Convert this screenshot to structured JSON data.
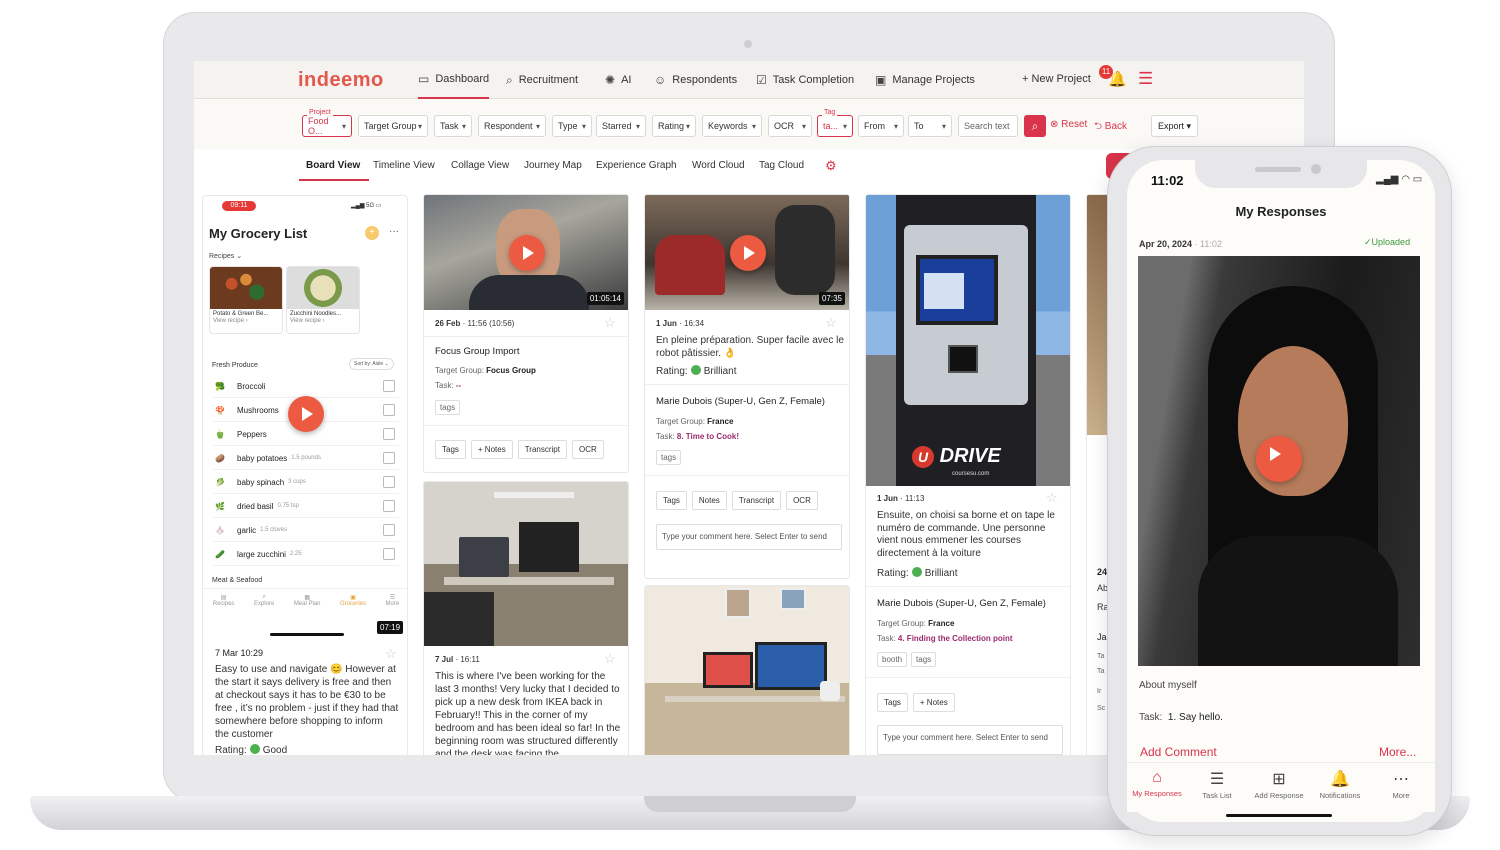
{
  "nav": {
    "logo": "indeemo",
    "items": [
      {
        "label": "Dashboard",
        "icon": "calendar-icon"
      },
      {
        "label": "Recruitment",
        "icon": "search-person-icon"
      },
      {
        "label": "AI",
        "icon": "lightbulb-icon"
      },
      {
        "label": "Respondents",
        "icon": "person-icon"
      },
      {
        "label": "Task Completion",
        "icon": "checkbox-icon"
      },
      {
        "label": "Manage Projects",
        "icon": "inbox-icon"
      }
    ],
    "new_project": "+ New Project",
    "notification_count": "11"
  },
  "filters": {
    "project_label": "Project",
    "project_value": "Food O...",
    "target_group": "Target Group",
    "task": "Task",
    "respondent": "Respondent",
    "type": "Type",
    "starred": "Starred",
    "rating": "Rating",
    "keywords": "Keywords",
    "ocr": "OCR",
    "tag_label": "Tag",
    "tag_value": "ta...",
    "from": "From",
    "to": "To",
    "search_placeholder": "Search text",
    "reset": "Reset",
    "back": "Back",
    "export": "Export"
  },
  "views": [
    "Board View",
    "Timeline View",
    "Collage View",
    "Journey Map",
    "Experience Graph",
    "Word Cloud",
    "Tag Cloud"
  ],
  "grocery": {
    "time": "09:11",
    "signal": "5G",
    "title": "My Grocery List",
    "recipes_label": "Recipes",
    "recipes": [
      {
        "name": "Potato & Green Be...",
        "link": "View recipe"
      },
      {
        "name": "Zucchini Noodles...",
        "link": "View recipe"
      }
    ],
    "section": "Fresh Produce",
    "sort": "Sort by: Aisle",
    "items": [
      {
        "name": "Broccoli",
        "qty": "",
        "icon": "🥦"
      },
      {
        "name": "Mushrooms",
        "qty": "",
        "icon": "🍄"
      },
      {
        "name": "Peppers",
        "qty": "",
        "icon": "🫑"
      },
      {
        "name": "baby potatoes",
        "qty": "1.5 pounds",
        "icon": "🥔"
      },
      {
        "name": "baby spinach",
        "qty": "3 cups",
        "icon": "🥬"
      },
      {
        "name": "dried basil",
        "qty": "0.75 tsp",
        "icon": "🌿"
      },
      {
        "name": "garlic",
        "qty": "1.5 cloves",
        "icon": "🧄"
      },
      {
        "name": "large zucchini",
        "qty": "2.25",
        "icon": "🥒"
      }
    ],
    "meat_section": "Meat & Seafood",
    "tabs": [
      "Recipes",
      "Explore",
      "Meal Plan",
      "Groceries",
      "More"
    ],
    "duration": "07:19",
    "date": "7 Mar 10:29",
    "text": "Easy to use and navigate 😊 However at the start it says delivery is free and then at checkout says it has to be €30 to be free , it’s no problem - just if they had that somewhere before shopping to inform the customer",
    "rating_label": "Rating:",
    "rating_value": "Good"
  },
  "cards": {
    "c1": {
      "duration": "01:05:14",
      "date": "26 Feb",
      "time": "· 11:56 (10:56)",
      "title": "Focus Group Import",
      "tg_label": "Target Group:",
      "tg_value": "Focus Group",
      "task_label": "Task:",
      "task_value": "--",
      "tag": "tags",
      "buttons": [
        "Tags",
        "+ Notes",
        "Transcript",
        "OCR"
      ]
    },
    "c2": {
      "date": "7 Jul",
      "time": "· 16:11",
      "text": "This is where I've been working for the last 3 months! Very lucky that I decided to pick up a new desk from IKEA back in February!! This in the corner of my bedroom and has been ideal so far! In the beginning room was structured differently and the desk was facing the"
    },
    "c3": {
      "duration": "07:35",
      "date": "1 Jun",
      "time": "· 16:34",
      "text": "En pleine préparation. Super facile avec le robot pâtissier. 👌",
      "rating_label": "Rating:",
      "rating_value": "Brilliant",
      "respondent": "Marie Dubois (Super-U, Gen Z, Female)",
      "tg_label": "Target Group:",
      "tg_value": "France",
      "task_label": "Task:",
      "task_value": "8. Time to Cook!",
      "tag": "tags",
      "buttons": [
        "Tags",
        "Notes",
        "Transcript",
        "OCR"
      ],
      "comment_placeholder": "Type your comment here. Select Enter to send"
    },
    "c4": {
      "brand": "DRIVE",
      "brand_sub": "coursesu.com",
      "date": "1 Jun",
      "time": "· 11:13",
      "text": "Ensuite, on choisi sa borne et on tape le numéro de commande. Une personne vient nous emmener les courses directement à la voiture",
      "rating_label": "Rating:",
      "rating_value": "Brilliant",
      "respondent": "Marie Dubois (Super-U, Gen Z, Female)",
      "tg_label": "Target Group:",
      "tg_value": "France",
      "task_label": "Task:",
      "task_value": "4. Finding the Collection point",
      "tags": [
        "booth",
        "tags"
      ],
      "buttons": [
        "Tags",
        "+ Notes"
      ],
      "comment_placeholder": "Type your comment here. Select Enter to send"
    },
    "c5_partial": [
      "24",
      "Ab",
      "Ra",
      "Ja",
      "Ta",
      "Ta",
      "Ir",
      "Sc"
    ]
  },
  "phone": {
    "time": "11:02",
    "title": "My Responses",
    "date": "Apr 20, 2024",
    "time_small": "· 11:02",
    "status": "✓Uploaded",
    "about": "About myself",
    "task_label": "Task:",
    "task_value": "1. Say hello.",
    "add_comment": "Add Comment",
    "more": "More...",
    "tabs": [
      {
        "label": "My Responses",
        "icon": "⌂"
      },
      {
        "label": "Task List",
        "icon": "☰"
      },
      {
        "label": "Add Response",
        "icon": "⊞"
      },
      {
        "label": "Notifications",
        "icon": "🔔"
      },
      {
        "label": "More",
        "icon": "⋯"
      }
    ]
  },
  "colors": {
    "accent": "#d9344b",
    "play": "#ec5a42",
    "link": "#9c2b6d",
    "success": "#3c9b3c"
  }
}
